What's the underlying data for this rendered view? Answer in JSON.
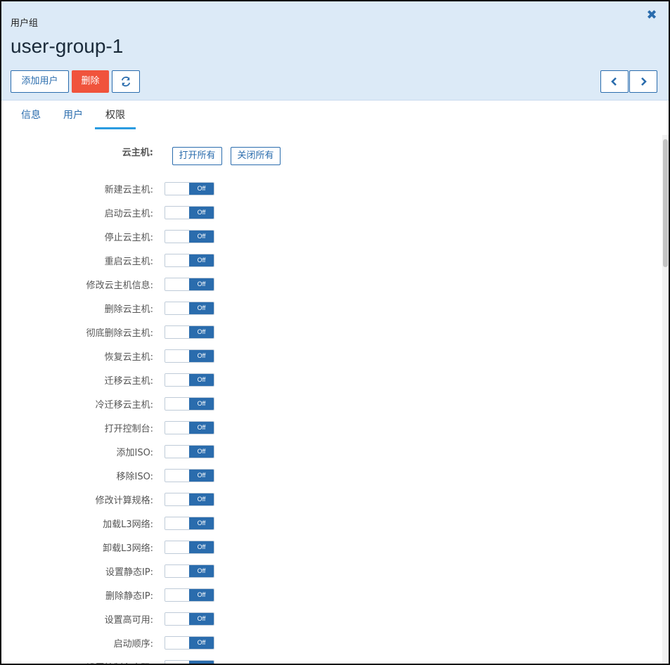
{
  "header": {
    "subtitle": "用户组",
    "title": "user-group-1",
    "close_icon": "close-icon",
    "add_user_label": "添加用户",
    "delete_label": "删除",
    "refresh_icon": "refresh-icon",
    "prev_icon": "chevron-left-icon",
    "next_icon": "chevron-right-icon"
  },
  "tabs": [
    {
      "label": "信息",
      "active": false
    },
    {
      "label": "用户",
      "active": false
    },
    {
      "label": "权限",
      "active": true
    }
  ],
  "section": {
    "label": "云主机:",
    "open_all": "打开所有",
    "close_all": "关闭所有"
  },
  "permissions": [
    {
      "label": "新建云主机:",
      "state": "Off"
    },
    {
      "label": "启动云主机:",
      "state": "Off"
    },
    {
      "label": "停止云主机:",
      "state": "Off"
    },
    {
      "label": "重启云主机:",
      "state": "Off"
    },
    {
      "label": "修改云主机信息:",
      "state": "Off"
    },
    {
      "label": "删除云主机:",
      "state": "Off"
    },
    {
      "label": "彻底删除云主机:",
      "state": "Off"
    },
    {
      "label": "恢复云主机:",
      "state": "Off"
    },
    {
      "label": "迁移云主机:",
      "state": "Off"
    },
    {
      "label": "冷迁移云主机:",
      "state": "Off"
    },
    {
      "label": "打开控制台:",
      "state": "Off"
    },
    {
      "label": "添加ISO:",
      "state": "Off"
    },
    {
      "label": "移除ISO:",
      "state": "Off"
    },
    {
      "label": "修改计算规格:",
      "state": "Off"
    },
    {
      "label": "加载L3网络:",
      "state": "Off"
    },
    {
      "label": "卸载L3网络:",
      "state": "Off"
    },
    {
      "label": "设置静态IP:",
      "state": "Off"
    },
    {
      "label": "删除静态IP:",
      "state": "Off"
    },
    {
      "label": "设置高可用:",
      "state": "Off"
    },
    {
      "label": "启动顺序:",
      "state": "Off"
    },
    {
      "label": "设置控制台密码:",
      "state": "Off"
    }
  ],
  "colors": {
    "header_bg": "#dceaf7",
    "accent": "#2a6cad",
    "danger": "#f0533c",
    "tab_underline": "#2a9be0"
  }
}
